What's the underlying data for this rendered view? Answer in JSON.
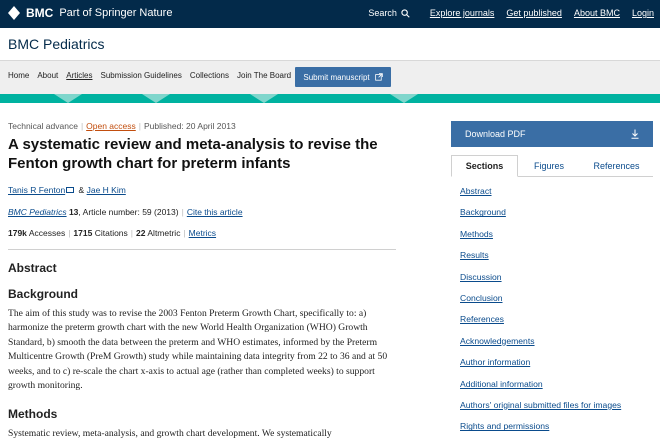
{
  "topbar": {
    "brand": "BMC",
    "brand_sub": "Part of Springer Nature",
    "search_label": "Search",
    "links": [
      "Explore journals",
      "Get published",
      "About BMC",
      "Login"
    ]
  },
  "journal": {
    "title": "BMC Pediatrics"
  },
  "nav": {
    "items": [
      "Home",
      "About",
      "Articles",
      "Submission Guidelines",
      "Collections",
      "Join The Board"
    ],
    "active": "Articles",
    "submit_label": "Submit manuscript"
  },
  "article": {
    "type": "Technical advance",
    "access": "Open access",
    "published": "Published: 20 April 2013",
    "title": "A systematic review and meta-analysis to revise the Fenton growth chart for preterm infants",
    "authors": [
      "Tanis R Fenton",
      "Jae H Kim"
    ],
    "author_separator": "&",
    "journal": "BMC Pediatrics",
    "volume": "13",
    "article_number": ", Article number: 59 (2013)",
    "cite_label": "Cite this article",
    "metrics": {
      "accesses_value": "179k",
      "accesses_label": "Accesses",
      "citations_value": "1715",
      "citations_label": "Citations",
      "altmetric_value": "22",
      "altmetric_label": "Altmetric",
      "metrics_link": "Metrics"
    },
    "abstract_heading": "Abstract",
    "background_heading": "Background",
    "background_text": "The aim of this study was to revise the 2003 Fenton Preterm Growth Chart, specifically to: a) harmonize the preterm growth chart with the new World Health Organization (WHO) Growth Standard, b) smooth the data between the preterm and WHO estimates, informed by the Preterm Multicentre Growth (PreM Growth) study while maintaining data integrity from 22 to 36 and at 50 weeks, and to c) re-scale the chart x-axis to actual age (rather than completed weeks) to support growth monitoring.",
    "methods_heading": "Methods",
    "methods_text": "Systematic review, meta-analysis, and growth chart development. We systematically"
  },
  "sidebar": {
    "download_label": "Download PDF",
    "tabs": [
      "Sections",
      "Figures",
      "References"
    ],
    "active_tab": "Sections",
    "toc": [
      "Abstract",
      "Background",
      "Methods",
      "Results",
      "Discussion",
      "Conclusion",
      "References",
      "Acknowledgements",
      "Author information",
      "Additional information",
      "Authors' original submitted files for images",
      "Rights and permissions"
    ]
  },
  "colors": {
    "topbar": "#032a4a",
    "accent_button": "#3a6ea5",
    "stripe": "#00b2a0",
    "link": "#0a4b8c",
    "open_access": "#c24e0e"
  }
}
